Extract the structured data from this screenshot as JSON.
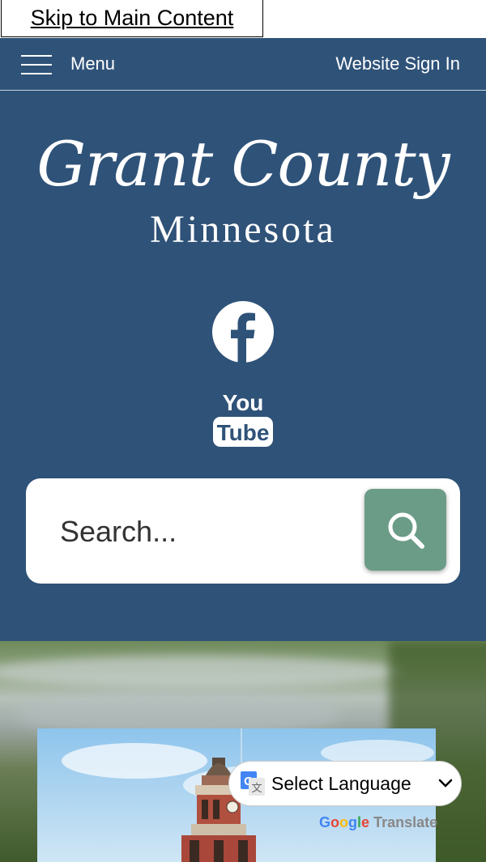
{
  "skip_link": {
    "label": "Skip to Main Content"
  },
  "topnav": {
    "menu_label": "Menu",
    "signin_label": "Website Sign In"
  },
  "logo": {
    "title": "Grant County",
    "subtitle": "Minnesota"
  },
  "social": {
    "facebook_icon": "facebook-icon",
    "youtube_icon": "youtube-icon",
    "youtube_line1": "You",
    "youtube_line2": "Tube"
  },
  "search": {
    "placeholder": "Search...",
    "icon": "search-icon"
  },
  "translate": {
    "select_label": "Select Language",
    "powered_by": {
      "google": [
        "G",
        "o",
        "o",
        "g",
        "l",
        "e"
      ],
      "translate": "Translate"
    }
  },
  "colors": {
    "header_blue": "#2f5278",
    "search_button_green": "#6b9c87",
    "white": "#ffffff"
  }
}
